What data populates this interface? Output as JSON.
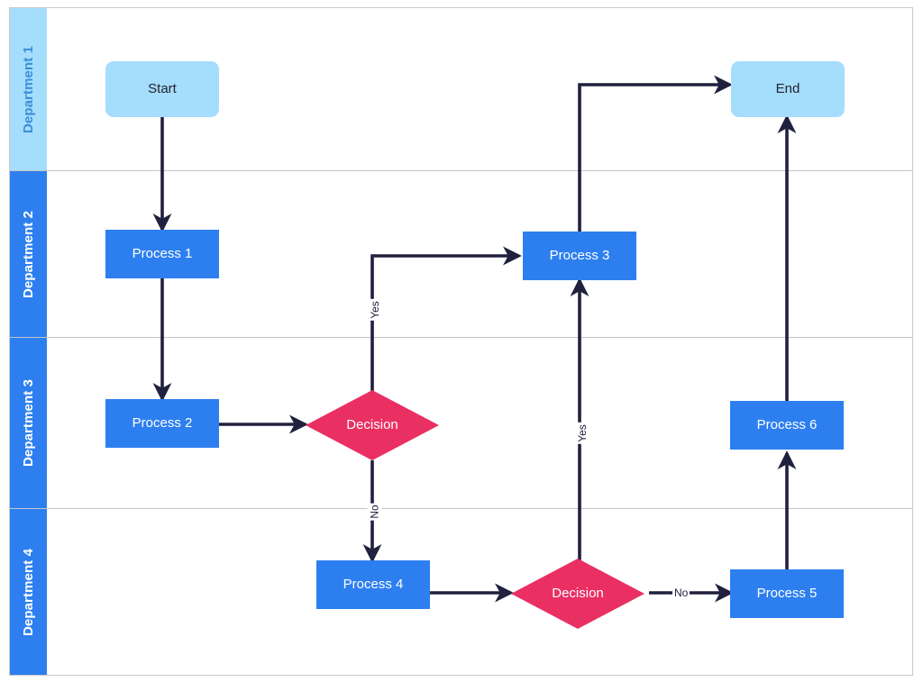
{
  "diagram": {
    "type": "cross-functional-flowchart",
    "colors": {
      "terminator_fill": "#a5ddfc",
      "terminator_text": "#20242e",
      "process_fill": "#2d7ff0",
      "process_text": "#ffffff",
      "decision_fill": "#ea2f63",
      "decision_text": "#ffffff",
      "connector": "#20203f",
      "lane_header_active": "#a5ddfc",
      "lane_header": "#2d7ff0",
      "lane_divider": "#c4c4c4",
      "canvas_border": "#c9c9c9",
      "canvas_background": "#ffffff"
    },
    "lanes": [
      {
        "label": "Department 1",
        "header_fill": "#a5ddfc",
        "header_text": "#3a8fd8"
      },
      {
        "label": "Department 2",
        "header_fill": "#2d7ff0",
        "header_text": "#ffffff"
      },
      {
        "label": "Department 3",
        "header_fill": "#2d7ff0",
        "header_text": "#ffffff"
      },
      {
        "label": "Department 4",
        "header_fill": "#2d7ff0",
        "header_text": "#ffffff"
      }
    ],
    "nodes": [
      {
        "id": "start",
        "label": "Start",
        "shape": "terminator",
        "lane": "Department 1"
      },
      {
        "id": "end",
        "label": "End",
        "shape": "terminator",
        "lane": "Department 1"
      },
      {
        "id": "process1",
        "label": "Process 1",
        "shape": "process",
        "lane": "Department 2"
      },
      {
        "id": "process3",
        "label": "Process 3",
        "shape": "process",
        "lane": "Department 2"
      },
      {
        "id": "process2",
        "label": "Process 2",
        "shape": "process",
        "lane": "Department 3"
      },
      {
        "id": "decision1",
        "label": "Decision",
        "shape": "decision",
        "lane": "Department 3"
      },
      {
        "id": "process6",
        "label": "Process 6",
        "shape": "process",
        "lane": "Department 3"
      },
      {
        "id": "process4",
        "label": "Process 4",
        "shape": "process",
        "lane": "Department 4"
      },
      {
        "id": "decision2",
        "label": "Decision",
        "shape": "decision",
        "lane": "Department 4"
      },
      {
        "id": "process5",
        "label": "Process 5",
        "shape": "process",
        "lane": "Department 4"
      }
    ],
    "edges": [
      {
        "from": "start",
        "to": "process1",
        "label": ""
      },
      {
        "from": "process1",
        "to": "process2",
        "label": ""
      },
      {
        "from": "process2",
        "to": "decision1",
        "label": ""
      },
      {
        "from": "decision1",
        "to": "process3",
        "label": "Yes"
      },
      {
        "from": "decision1",
        "to": "process4",
        "label": "No"
      },
      {
        "from": "process3",
        "to": "end",
        "label": ""
      },
      {
        "from": "process4",
        "to": "decision2",
        "label": ""
      },
      {
        "from": "decision2",
        "to": "process3",
        "label": "Yes"
      },
      {
        "from": "decision2",
        "to": "process5",
        "label": "No"
      },
      {
        "from": "process5",
        "to": "process6",
        "label": ""
      },
      {
        "from": "process6",
        "to": "end",
        "label": ""
      }
    ],
    "edge_labels": {
      "yes_decision1": "Yes",
      "no_decision1": "No",
      "yes_decision2": "Yes",
      "no_decision2": "No"
    }
  }
}
